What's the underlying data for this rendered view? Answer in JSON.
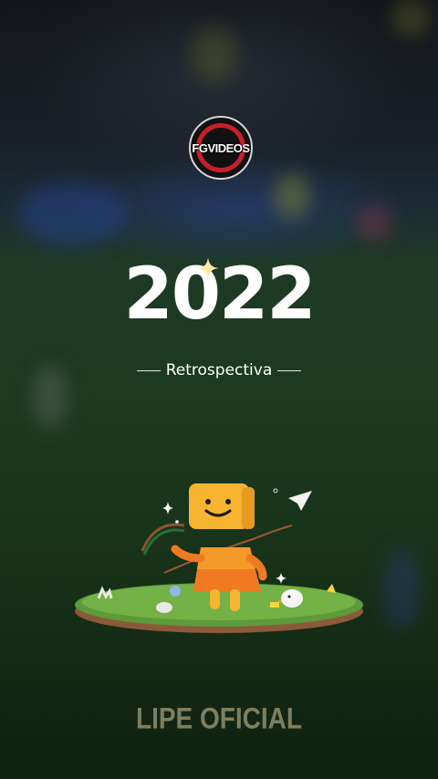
{
  "logo": {
    "text": "FGVIDEOS"
  },
  "header": {
    "year": "2022",
    "subtitle": "Retrospectiva"
  },
  "footer": {
    "credit": "LIPE OFICIAL"
  },
  "colors": {
    "accent_red": "#c8202a",
    "text_white": "#ffffff",
    "footer_olive": "#7d7f5f",
    "mascot_yellow": "#f6b431",
    "mascot_orange": "#f07a21"
  }
}
